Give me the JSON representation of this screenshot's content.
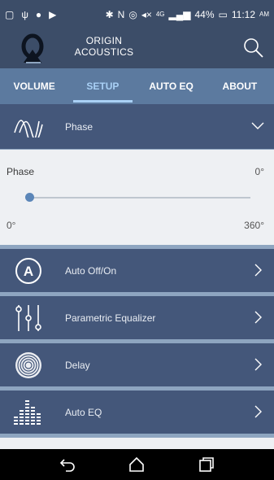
{
  "status_bar": {
    "battery": "44%",
    "time": "11:12",
    "ampm": "AM",
    "network": "4G"
  },
  "header": {
    "brand_line1": "ORIGIN",
    "brand_line2": "ACOUSTICS"
  },
  "tabs": [
    {
      "label": "VOLUME"
    },
    {
      "label": "SETUP"
    },
    {
      "label": "AUTO EQ"
    },
    {
      "label": "ABOUT"
    }
  ],
  "phase_section": {
    "header_label": "Phase",
    "title": "Phase",
    "value": "0°",
    "min_label": "0°",
    "max_label": "360°",
    "slider_fraction": 0.0
  },
  "menu_items": [
    {
      "label": "Auto Off/On",
      "icon": "auto-icon",
      "icon_letter": "A"
    },
    {
      "label": "Parametric Equalizer",
      "icon": "equalizer-sliders-icon"
    },
    {
      "label": "Delay",
      "icon": "delay-rings-icon"
    },
    {
      "label": "Auto EQ",
      "icon": "bars-graph-icon"
    }
  ],
  "colors": {
    "header_bg": "#3c4d68",
    "tab_bg": "#5c7a9f",
    "row_bg": "#44577a",
    "active_tab": "#a9d0f5",
    "accent": "#5b86b8"
  }
}
